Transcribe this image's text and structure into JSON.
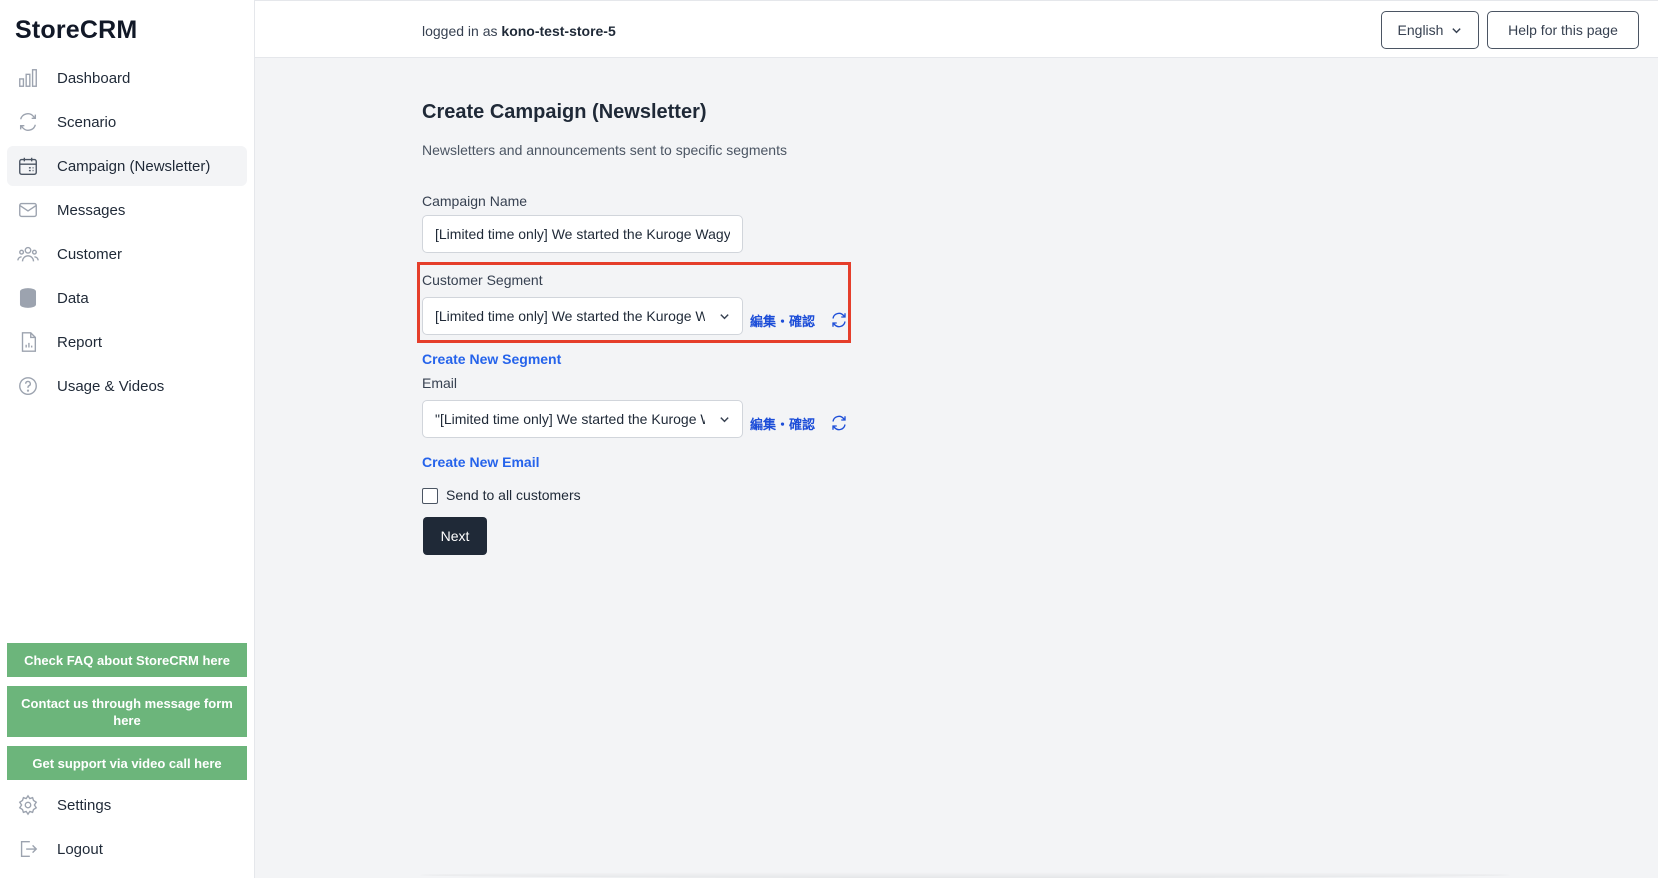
{
  "app": {
    "logo": "StoreCRM"
  },
  "sidebar": {
    "items": [
      {
        "label": "Dashboard",
        "icon": "bar-chart-icon"
      },
      {
        "label": "Scenario",
        "icon": "refresh-arrows-icon"
      },
      {
        "label": "Campaign (Newsletter)",
        "icon": "calendar-icon",
        "active": true
      },
      {
        "label": "Messages",
        "icon": "envelope-icon"
      },
      {
        "label": "Customer",
        "icon": "users-icon"
      },
      {
        "label": "Data",
        "icon": "database-icon"
      },
      {
        "label": "Report",
        "icon": "document-chart-icon"
      },
      {
        "label": "Usage & Videos",
        "icon": "question-circle-icon"
      }
    ],
    "help_buttons": [
      "Check FAQ about StoreCRM here",
      "Contact us through message form here",
      "Get support via video call here"
    ],
    "settings_label": "Settings",
    "logout_label": "Logout",
    "help_button_color": "#6cb57b"
  },
  "topbar": {
    "logged_prefix": "logged in as",
    "store_name": "kono-test-store-5",
    "language": "English",
    "help_label": "Help for this page"
  },
  "main": {
    "title": "Create Campaign (Newsletter)",
    "subtitle": "Newsletters and announcements sent to specific segments",
    "campaign_name_label": "Campaign Name",
    "campaign_name_value": "[Limited time only] We started the Kuroge Wagyu campaign",
    "segment_label": "Customer Segment",
    "segment_value": "[Limited time only] We started the Kuroge Wagyu campaign",
    "segment_edit_link": "編集・確認",
    "create_segment_link": "Create New Segment",
    "email_label": "Email",
    "email_value": "\"[Limited time only] We started the Kuroge Wagyu campaign\"",
    "email_edit_link": "編集・確認",
    "create_email_link": "Create New Email",
    "send_all_label": "Send to all customers",
    "next_label": "Next",
    "highlight_color": "#e53e2b",
    "link_color": "#2563eb"
  }
}
